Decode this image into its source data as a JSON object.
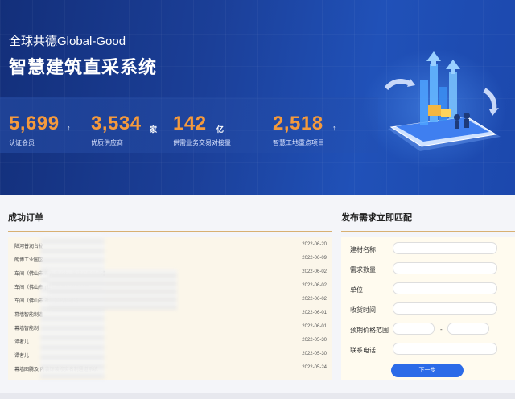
{
  "hero": {
    "subtitle": "全球共德Global-Good",
    "title": "智慧建筑直采系统"
  },
  "stats": [
    {
      "value": "5,699",
      "unit": "↑",
      "label": "认证会员"
    },
    {
      "value": "3,534",
      "unit": "家",
      "label": "优质供应商"
    },
    {
      "value": "142",
      "unit": "亿",
      "label": "供需业务交易对接量"
    },
    {
      "value": "2,518",
      "unit": "↑",
      "label": "智慧工地重点项目"
    }
  ],
  "orders": {
    "title": "成功订单",
    "rows": [
      {
        "text": "陆河普润台秘",
        "date": "2022-06-20"
      },
      {
        "text": "朗博工业园区",
        "date": "2022-06-09"
      },
      {
        "text": "车间（佛山市南                              东莞                    (社）需求实名制通道",
        "date": "2022-06-02"
      },
      {
        "text": "车间（佛山市                                                   (社）需求实名制通道",
        "date": "2022-06-02"
      },
      {
        "text": "车间（佛山市                                  社）实名制通道",
        "date": "2022-06-02"
      },
      {
        "text": "幕墙智能制造",
        "date": "2022-06-01"
      },
      {
        "text": "幕墙智能制                               ",
        "date": "2022-06-01"
      },
      {
        "text": "谭者儿",
        "date": "2022-05-30"
      },
      {
        "text": "谭者儿",
        "date": "2022-05-30"
      },
      {
        "text": "幕墙图腾及                                                       内装饰装修实名制通道系统",
        "date": "2022-05-24"
      }
    ]
  },
  "form": {
    "title": "发布需求立即匹配",
    "fields": [
      {
        "label": "建材名称",
        "value": ""
      },
      {
        "label": "需求数量",
        "value": ""
      },
      {
        "label": "单位",
        "value": ""
      },
      {
        "label": "收货时间",
        "value": ""
      }
    ],
    "price_label": "预期价格范围",
    "price_sep": "-",
    "phone_label": "联系电话",
    "next_button": "下一步"
  },
  "colors": {
    "accent_orange": "#f59a3c",
    "primary_blue": "#2c6be8",
    "divider_gold": "#d8b072"
  }
}
